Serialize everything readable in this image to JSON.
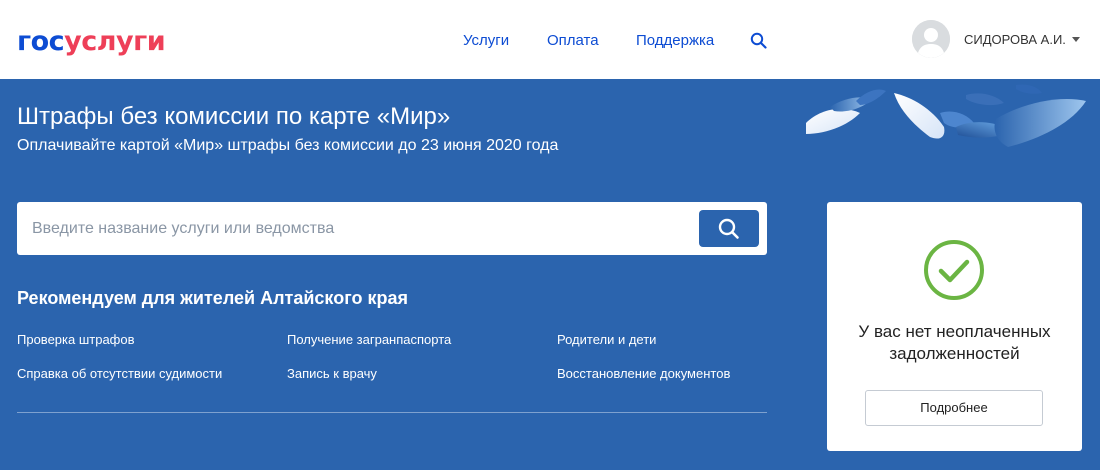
{
  "header": {
    "logo_part1": "гос",
    "logo_part2": "услуги",
    "nav": [
      {
        "label": "Услуги"
      },
      {
        "label": "Оплата"
      },
      {
        "label": "Поддержка"
      }
    ],
    "search_icon": "search-icon",
    "user_name": "СИДОРОВА А.И.",
    "avatar_icon": "user-silhouette-icon"
  },
  "banner": {
    "title": "Штрафы без комиссии по карте «Мир»",
    "subtitle": "Оплачивайте картой «Мир» штрафы без комиссии до 23 июня 2020 года",
    "background": "#2b64ae"
  },
  "search": {
    "placeholder": "Введите название услуги или ведомства",
    "value": "",
    "button_icon": "search-icon"
  },
  "recommended": {
    "title": "Рекомендуем для жителей Алтайского края",
    "links": [
      {
        "label": "Проверка штрафов"
      },
      {
        "label": "Получение загранпаспорта"
      },
      {
        "label": "Родители и дети"
      },
      {
        "label": "Справка об отсутствии судимости"
      },
      {
        "label": "Запись к врачу"
      },
      {
        "label": "Восстановление документов"
      }
    ]
  },
  "debt_card": {
    "status_icon": "check-circle-icon",
    "status_color": "#6bb543",
    "message": "У вас нет неоплаченных задолженностей",
    "button_label": "Подробнее"
  },
  "colors": {
    "brand_blue": "#0d4cd3",
    "brand_red": "#ee3f58"
  }
}
